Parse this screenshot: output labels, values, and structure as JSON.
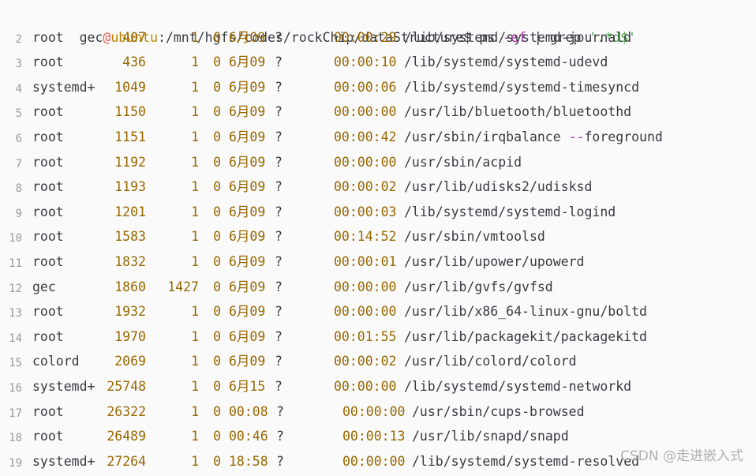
{
  "prompt": {
    "user": "gec",
    "at": "@",
    "host": "ubuntu",
    "path": ":/mnt/hgfs/codes/rockChip/dataStructure$ ",
    "cmd": "ps ",
    "opt": "-ef",
    "pipe": " | grep ",
    "pattern": "'.*d$'"
  },
  "processes": [
    {
      "ln": "2",
      "user": "root",
      "pid": "407",
      "ppid": "1",
      "c": "0",
      "stime": "6月09",
      "tty": "?",
      "time": "00:00:29",
      "cmd": "/lib/systemd/systemd-journald"
    },
    {
      "ln": "3",
      "user": "root",
      "pid": "436",
      "ppid": "1",
      "c": "0",
      "stime": "6月09",
      "tty": "?",
      "time": "00:00:10",
      "cmd": "/lib/systemd/systemd-udevd"
    },
    {
      "ln": "4",
      "user": "systemd+",
      "pid": "1049",
      "ppid": "1",
      "c": "0",
      "stime": "6月09",
      "tty": "?",
      "time": "00:00:06",
      "cmd": "/lib/systemd/systemd-timesyncd"
    },
    {
      "ln": "5",
      "user": "root",
      "pid": "1150",
      "ppid": "1",
      "c": "0",
      "stime": "6月09",
      "tty": "?",
      "time": "00:00:00",
      "cmd": "/usr/lib/bluetooth/bluetoothd"
    },
    {
      "ln": "6",
      "user": "root",
      "pid": "1151",
      "ppid": "1",
      "c": "0",
      "stime": "6月09",
      "tty": "?",
      "time": "00:00:42",
      "cmd": "/usr/sbin/irqbalance --foreground"
    },
    {
      "ln": "7",
      "user": "root",
      "pid": "1192",
      "ppid": "1",
      "c": "0",
      "stime": "6月09",
      "tty": "?",
      "time": "00:00:00",
      "cmd": "/usr/sbin/acpid"
    },
    {
      "ln": "8",
      "user": "root",
      "pid": "1193",
      "ppid": "1",
      "c": "0",
      "stime": "6月09",
      "tty": "?",
      "time": "00:00:02",
      "cmd": "/usr/lib/udisks2/udisksd"
    },
    {
      "ln": "9",
      "user": "root",
      "pid": "1201",
      "ppid": "1",
      "c": "0",
      "stime": "6月09",
      "tty": "?",
      "time": "00:00:03",
      "cmd": "/lib/systemd/systemd-logind"
    },
    {
      "ln": "10",
      "user": "root",
      "pid": "1583",
      "ppid": "1",
      "c": "0",
      "stime": "6月09",
      "tty": "?",
      "time": "00:14:52",
      "cmd": "/usr/sbin/vmtoolsd"
    },
    {
      "ln": "11",
      "user": "root",
      "pid": "1832",
      "ppid": "1",
      "c": "0",
      "stime": "6月09",
      "tty": "?",
      "time": "00:00:01",
      "cmd": "/usr/lib/upower/upowerd"
    },
    {
      "ln": "12",
      "user": "gec",
      "pid": "1860",
      "ppid": "1427",
      "c": "0",
      "stime": "6月09",
      "tty": "?",
      "time": "00:00:00",
      "cmd": "/usr/lib/gvfs/gvfsd"
    },
    {
      "ln": "13",
      "user": "root",
      "pid": "1932",
      "ppid": "1",
      "c": "0",
      "stime": "6月09",
      "tty": "?",
      "time": "00:00:00",
      "cmd": "/usr/lib/x86_64-linux-gnu/boltd"
    },
    {
      "ln": "14",
      "user": "root",
      "pid": "1970",
      "ppid": "1",
      "c": "0",
      "stime": "6月09",
      "tty": "?",
      "time": "00:01:55",
      "cmd": "/usr/lib/packagekit/packagekitd"
    },
    {
      "ln": "15",
      "user": "colord",
      "pid": "2069",
      "ppid": "1",
      "c": "0",
      "stime": "6月09",
      "tty": "?",
      "time": "00:00:02",
      "cmd": "/usr/lib/colord/colord"
    },
    {
      "ln": "16",
      "user": "systemd+",
      "pid": "25748",
      "ppid": "1",
      "c": "0",
      "stime": "6月15",
      "tty": "?",
      "time": "00:00:00",
      "cmd": "/lib/systemd/systemd-networkd"
    },
    {
      "ln": "17",
      "user": "root",
      "pid": "26322",
      "ppid": "1",
      "c": "0",
      "stime": "00:08",
      "tty": "?",
      "time": "00:00:00",
      "cmd": "/usr/sbin/cups-browsed"
    },
    {
      "ln": "18",
      "user": "root",
      "pid": "26489",
      "ppid": "1",
      "c": "0",
      "stime": "00:46",
      "tty": "?",
      "time": "00:00:13",
      "cmd": "/usr/lib/snapd/snapd"
    },
    {
      "ln": "19",
      "user": "systemd+",
      "pid": "27264",
      "ppid": "1",
      "c": "0",
      "stime": "18:58",
      "tty": "?",
      "time": "00:00:00",
      "cmd": "/lib/systemd/systemd-resolved"
    }
  ],
  "watermark": "CSDN @走进嵌入式"
}
